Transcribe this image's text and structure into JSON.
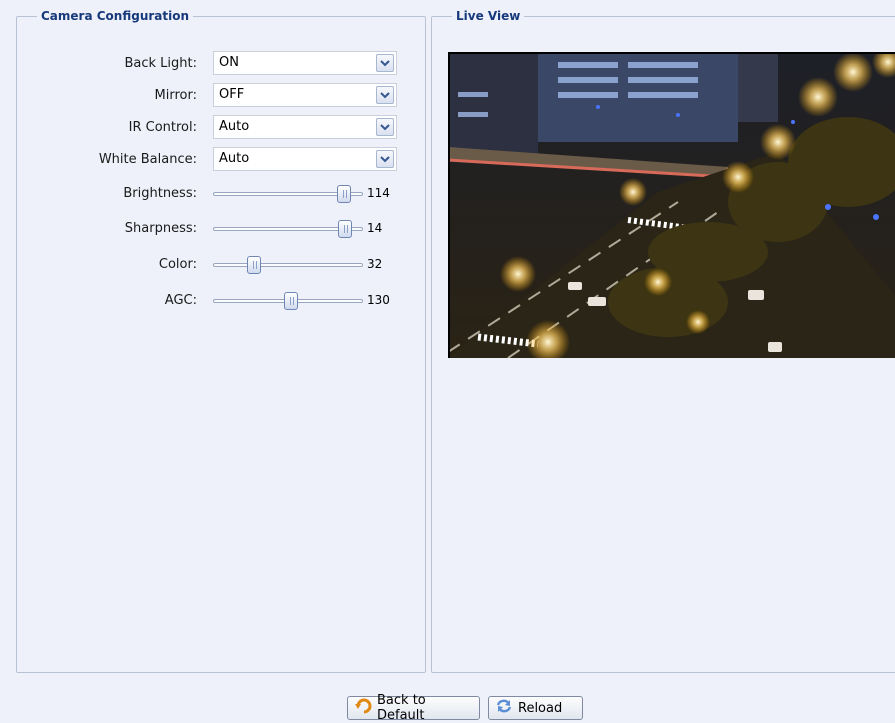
{
  "camera_config": {
    "legend": "Camera Configuration",
    "selects": [
      {
        "label": "Back Light:",
        "value": "ON"
      },
      {
        "label": "Mirror:",
        "value": "OFF"
      },
      {
        "label": "IR Control:",
        "value": "Auto"
      },
      {
        "label": "White Balance:",
        "value": "Auto"
      }
    ],
    "sliders": [
      {
        "label": "Brightness:",
        "value": "114",
        "level": 0.87
      },
      {
        "label": "Sharpness:",
        "value": "14",
        "level": 0.88
      },
      {
        "label": "Color:",
        "value": "32",
        "level": 0.27
      },
      {
        "label": "AGC:",
        "value": "130",
        "level": 0.52
      }
    ]
  },
  "live_view": {
    "legend": "Live View"
  },
  "buttons": {
    "back_to_default": "Back to Default",
    "reload": "Reload"
  },
  "icons": {
    "back_to_default": "undo-arrow-icon",
    "reload": "refresh-icon",
    "dropdown": "chevron-down-icon"
  },
  "colors": {
    "legend_text": "#17397b",
    "background": "#eef1f9",
    "panel_border": "#b9c2d4"
  }
}
